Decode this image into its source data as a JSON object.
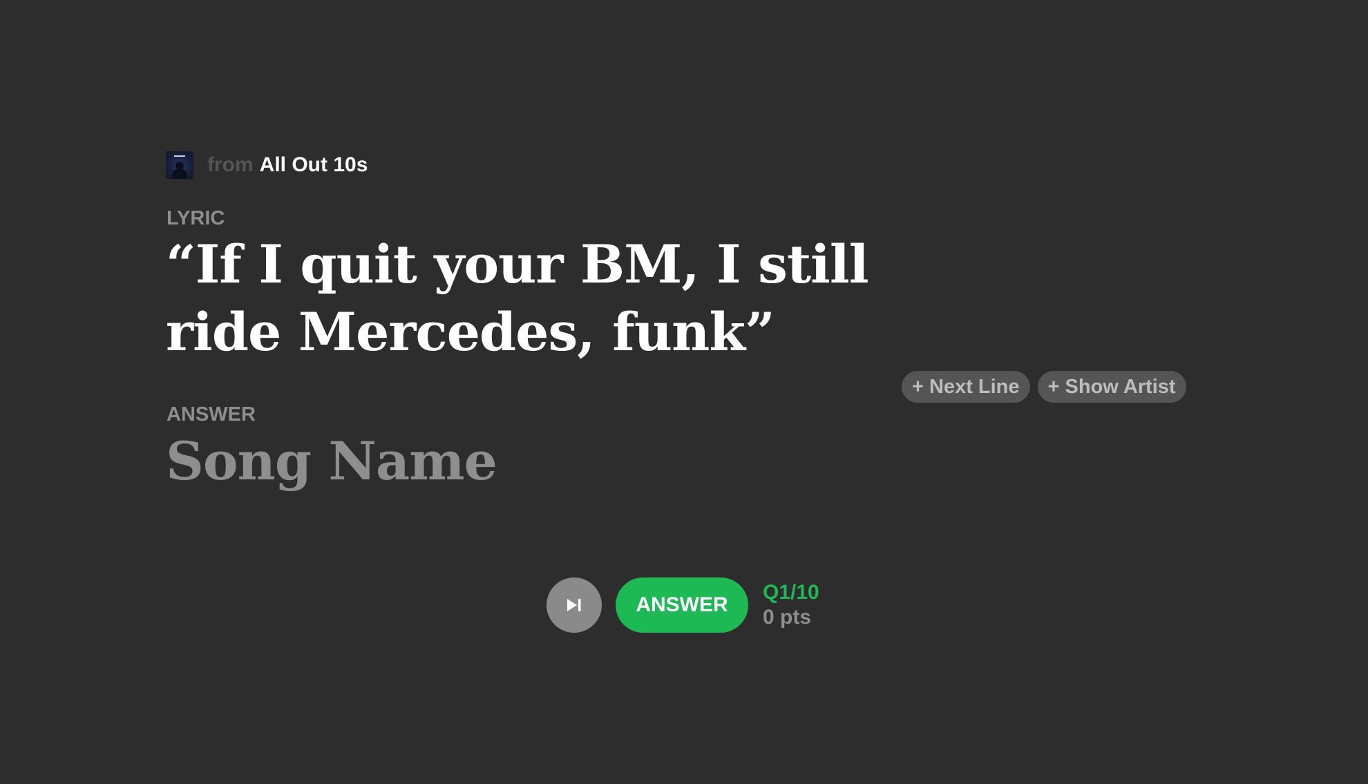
{
  "source": {
    "from_label": "from",
    "playlist_name": "All Out 10s",
    "cover_icon": "album-cover"
  },
  "lyric": {
    "label": "LYRIC",
    "text": "“If I quit your BM, I still ride Mercedes, funk”"
  },
  "hints": {
    "next_line": "+ Next Line",
    "show_artist": "+ Show Artist"
  },
  "answer": {
    "label": "ANSWER",
    "placeholder": "Song Name"
  },
  "controls": {
    "skip_icon": "skip-next-icon",
    "answer_button": "ANSWER",
    "question_counter": "Q1/10",
    "points": "0 pts"
  },
  "colors": {
    "background": "#2d2d2d",
    "accent": "#1db954",
    "muted": "#8e8e8e",
    "pill": "#555555"
  }
}
